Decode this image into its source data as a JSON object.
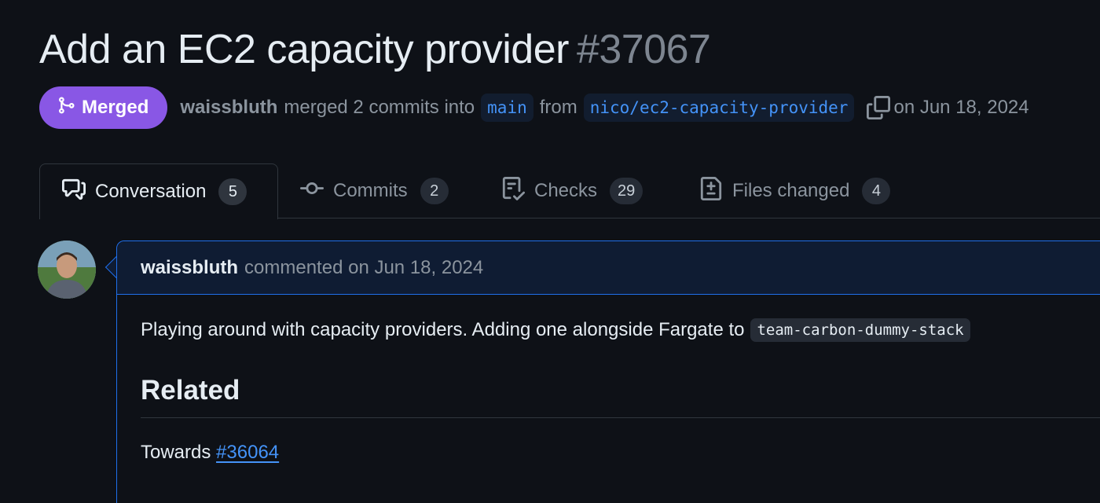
{
  "pr": {
    "title": "Add an EC2 capacity provider",
    "number": "#37067",
    "state": "Merged",
    "author": "waissbluth",
    "merge_text": "merged 2 commits into",
    "base_branch": "main",
    "from_text": "from",
    "head_branch": "nico/ec2-capacity-provider",
    "date_text": "on Jun 18, 2024"
  },
  "tabs": [
    {
      "label": "Conversation",
      "count": "5",
      "icon": "comment-discussion-icon",
      "active": true
    },
    {
      "label": "Commits",
      "count": "2",
      "icon": "git-commit-icon",
      "active": false
    },
    {
      "label": "Checks",
      "count": "29",
      "icon": "checklist-icon",
      "active": false
    },
    {
      "label": "Files changed",
      "count": "4",
      "icon": "file-diff-icon",
      "active": false
    }
  ],
  "comment": {
    "author": "waissbluth",
    "meta": "commented on Jun 18, 2024",
    "body_text": "Playing around with capacity providers. Adding one alongside Fargate to",
    "inline_code": "team-carbon-dummy-stack",
    "heading": "Related",
    "towards_text": "Towards",
    "towards_link": "#36064"
  },
  "colors": {
    "background": "#0e1117",
    "merged_badge": "#8957e5",
    "link": "#4493f8",
    "comment_border": "#1f6feb"
  }
}
